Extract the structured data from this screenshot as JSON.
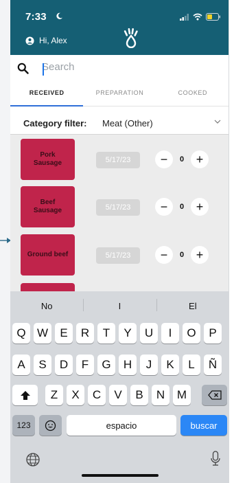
{
  "status_bar": {
    "time": "7:33"
  },
  "header": {
    "greeting": "Hi, Alex",
    "brand_color": "#155f74"
  },
  "search": {
    "placeholder": "Search",
    "value": ""
  },
  "tabs": [
    {
      "label": "RECEIVED",
      "active": true
    },
    {
      "label": "PREPARATION",
      "active": false
    },
    {
      "label": "COOKED",
      "active": false
    }
  ],
  "filter": {
    "label": "Category filter:",
    "value": "Meat (Other)"
  },
  "items": [
    {
      "name": "Pork\nSausage",
      "date": "5/17/23",
      "qty": "0"
    },
    {
      "name": "Beef\nSausage",
      "date": "5/17/23",
      "qty": "0"
    },
    {
      "name": "Ground beef",
      "date": "5/17/23",
      "qty": "0"
    }
  ],
  "product_color": "#c0244b",
  "keyboard": {
    "suggestions": [
      "No",
      "I",
      "El"
    ],
    "row1": [
      "Q",
      "W",
      "E",
      "R",
      "T",
      "Y",
      "U",
      "I",
      "O",
      "P"
    ],
    "row2": [
      "A",
      "S",
      "D",
      "F",
      "G",
      "H",
      "J",
      "K",
      "L",
      "Ñ"
    ],
    "row3": [
      "Z",
      "X",
      "C",
      "V",
      "B",
      "N",
      "M"
    ],
    "numbers_key": "123",
    "space_key": "espacio",
    "action_key": "buscar"
  },
  "icons": [
    "moon-icon",
    "signal-icon",
    "wifi-icon",
    "battery-icon",
    "user-circle-icon",
    "brand-hand-drop-icon",
    "search-icon",
    "chevron-down-icon",
    "minus-icon",
    "plus-icon",
    "shift-icon",
    "backspace-icon",
    "emoji-icon",
    "globe-icon",
    "microphone-icon"
  ]
}
